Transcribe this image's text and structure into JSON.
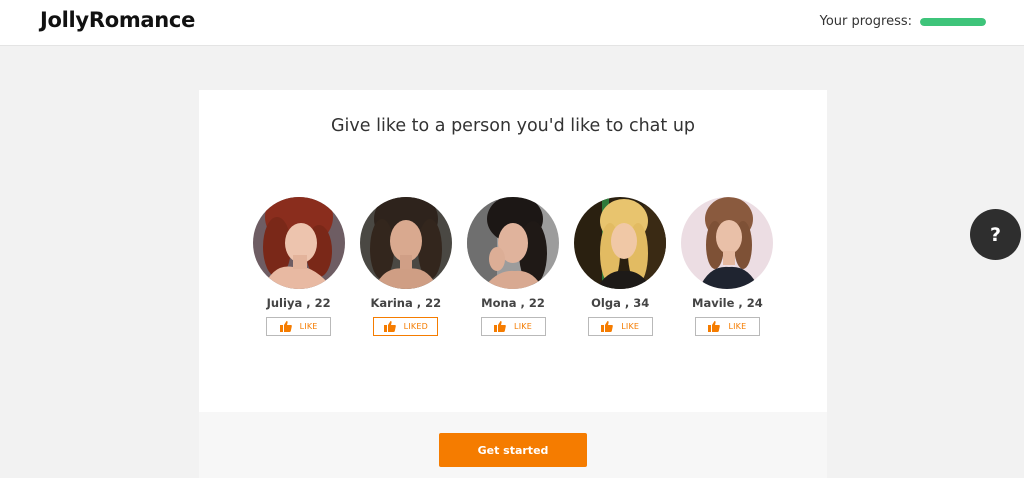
{
  "header": {
    "logo": "JollyRomance",
    "progress_label": "Your progress:",
    "progress_fraction": 1.0,
    "progress_color": "#3ec47a"
  },
  "card": {
    "title": "Give like to a person you'd like to chat up"
  },
  "people": [
    {
      "name": "Juliya",
      "age": "22",
      "like_label": "LIKE",
      "liked": false
    },
    {
      "name": "Karina",
      "age": "22",
      "like_label": "LIKED",
      "liked": true
    },
    {
      "name": "Mona",
      "age": "22",
      "like_label": "LIKE",
      "liked": false
    },
    {
      "name": "Olga",
      "age": "34",
      "like_label": "LIKE",
      "liked": false
    },
    {
      "name": "Mavile",
      "age": "24",
      "like_label": "LIKE",
      "liked": false
    }
  ],
  "footer": {
    "cta_label": "Get started"
  },
  "help": {
    "label": "?"
  },
  "colors": {
    "accent": "#f57c00",
    "progress": "#3ec47a",
    "help_bg": "#2e2e2e"
  },
  "icons": {
    "like": "thumbs-up-icon",
    "help": "question-mark-icon"
  }
}
